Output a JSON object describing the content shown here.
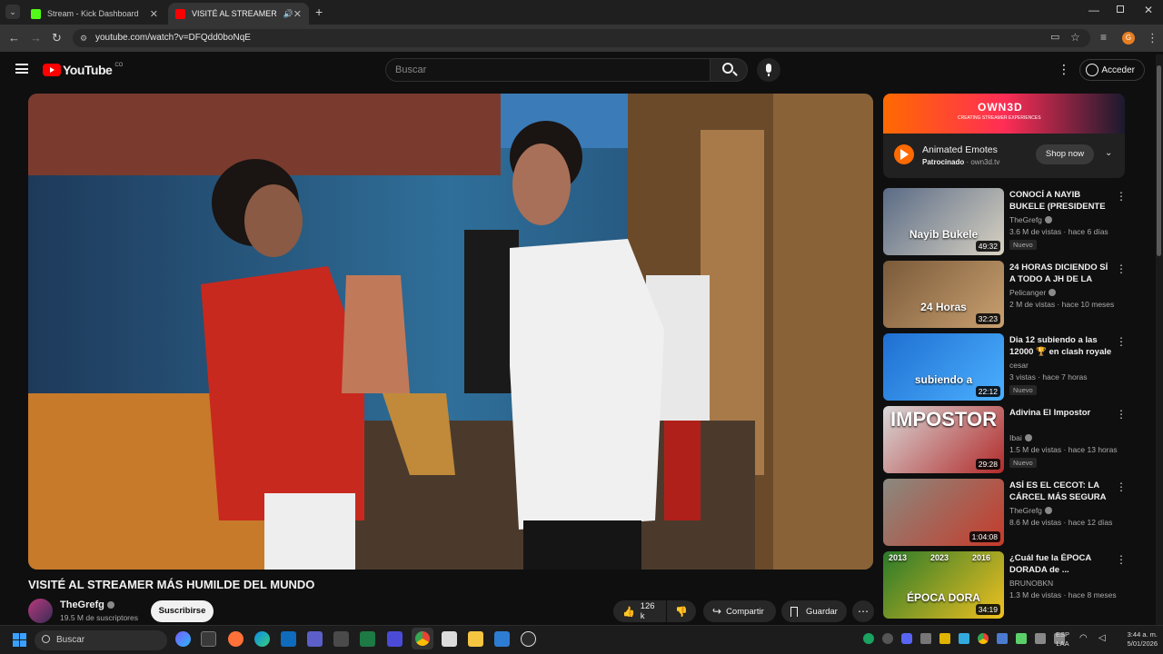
{
  "browser": {
    "tabs": [
      {
        "title": "Stream - Kick Dashboard",
        "active": false,
        "favicon_color": "#53fc18"
      },
      {
        "title": "VISITÉ AL STREAMER MÁS I",
        "active": true,
        "favicon_color": "#ff0000"
      }
    ],
    "new_tab": "+",
    "url": "youtube.com/watch?v=DFQdd0boNqE",
    "profile_initial": "G"
  },
  "youtube": {
    "logo_text": "YouTube",
    "region": "CO",
    "search_placeholder": "Buscar",
    "signin_label": "Acceder"
  },
  "video": {
    "title": "VISITÉ AL STREAMER MÁS HUMILDE DEL MUNDO",
    "channel": "TheGrefg",
    "subscribers": "19.5 M de suscriptores",
    "subscribe_label": "Suscribirse",
    "likes": "126 k",
    "share_label": "Compartir",
    "save_label": "Guardar"
  },
  "ad": {
    "title": "Animated Emotes",
    "sponsored": "Patrocinado",
    "domain": "own3d.tv",
    "cta": "Shop now",
    "banner_text": "OWN3D",
    "banner_sub": "CREATING STREAMER EXPERIENCES"
  },
  "recommendations": [
    {
      "title": "CONOCÍ A NAYIB BUKELE (PRESIDENTE DE EL ...",
      "channel": "TheGrefg",
      "verified": true,
      "stats": "3.6 M de vistas · hace 6 días",
      "badge": "Nuevo",
      "duration": "49:32",
      "thumb_colors": [
        "#5a6b86",
        "#d8d2c2"
      ],
      "thumb_text": "Nayib Bukele"
    },
    {
      "title": "24 HORAS DICIENDO SÍ A TODO A JH DE LA CRUZ ...",
      "channel": "Pelicanger",
      "verified": true,
      "stats": "2 M de vistas · hace 10 meses",
      "badge": "",
      "duration": "32:23",
      "thumb_colors": [
        "#7a5a3a",
        "#c9a070"
      ],
      "thumb_text": "24 Horas"
    },
    {
      "title": "Dia 12 subiendo a las 12000 🏆 en clash royale",
      "channel": "cesar",
      "verified": false,
      "stats": "3 vistas · hace 7 horas",
      "badge": "Nuevo",
      "duration": "22:12",
      "thumb_colors": [
        "#1f6fd1",
        "#4bb0ff"
      ],
      "thumb_text": "subiendo a"
    },
    {
      "title": "Adivina El Impostor",
      "channel": "Ibai",
      "verified": true,
      "stats": "1.5 M de vistas · hace 13 horas",
      "badge": "Nuevo",
      "duration": "29:28",
      "thumb_colors": [
        "#d9d9d9",
        "#b22a2a"
      ],
      "thumb_text": "IMPOSTOR"
    },
    {
      "title": "ASÍ ES EL CECOT: LA CÁRCEL MÁS SEGURA D...",
      "channel": "TheGrefg",
      "verified": true,
      "stats": "8.6 M de vistas · hace 12 días",
      "badge": "",
      "duration": "1:04:08",
      "thumb_colors": [
        "#8a8a80",
        "#c63a2a"
      ],
      "thumb_text": ""
    },
    {
      "title": "¿Cuál fue la ÉPOCA DORADA de ...",
      "channel": "BRUNOBKN",
      "verified": false,
      "stats": "1.3 M de vistas · hace 8 meses",
      "badge": "",
      "duration": "34:19",
      "thumb_colors": [
        "#2a7a2a",
        "#f0c020"
      ],
      "thumb_text": "ÉPOCA DORA"
    }
  ],
  "thumb_years": [
    "2013",
    "2023",
    "2016"
  ],
  "taskbar": {
    "search_placeholder": "Buscar",
    "lang": "ESP",
    "lang_sub": "LAA",
    "time": "3:44 a. m.",
    "date": "5/01/2026"
  }
}
